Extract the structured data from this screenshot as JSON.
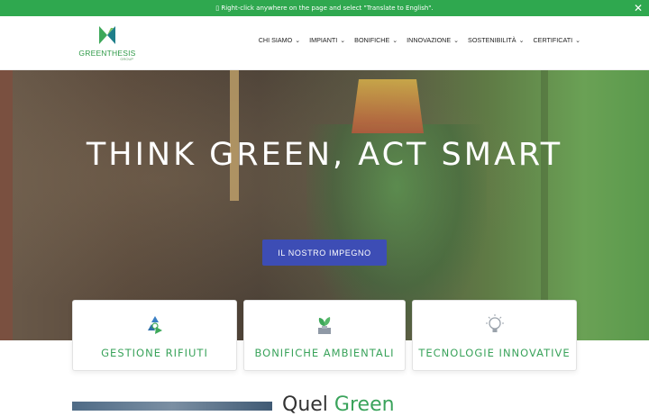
{
  "notice": {
    "text": "▯ Right-click anywhere on the page and select \"Translate to English\".",
    "close_icon": "close-icon"
  },
  "logo": {
    "brand": "GREENTHESIS",
    "sub": "GROUP"
  },
  "nav": {
    "items": [
      {
        "label": "CHI SIAMO"
      },
      {
        "label": "IMPIANTI"
      },
      {
        "label": "BONIFICHE"
      },
      {
        "label": "INNOVAZIONE"
      },
      {
        "label": "SOSTENIBILITÀ"
      },
      {
        "label": "CERTIFICATI"
      }
    ],
    "chevron": "⌄"
  },
  "hero": {
    "title": "THINK GREEN, ACT SMART",
    "cta_label": "IL NOSTRO IMPEGNO"
  },
  "cards": [
    {
      "label": "GESTIONE RIFIUTI",
      "icon": "recycle-icon"
    },
    {
      "label": "BONIFICHE AMBIENTALI",
      "icon": "plant-icon"
    },
    {
      "label": "TECNOLOGIE INNOVATIVE",
      "icon": "lightbulb-icon"
    }
  ],
  "below": {
    "heading_start": "Quel",
    "heading_green": "Green"
  },
  "colors": {
    "accent_green": "#2fa84f",
    "card_text_green": "#3aa35b",
    "cta_blue": "#3d4db5"
  }
}
